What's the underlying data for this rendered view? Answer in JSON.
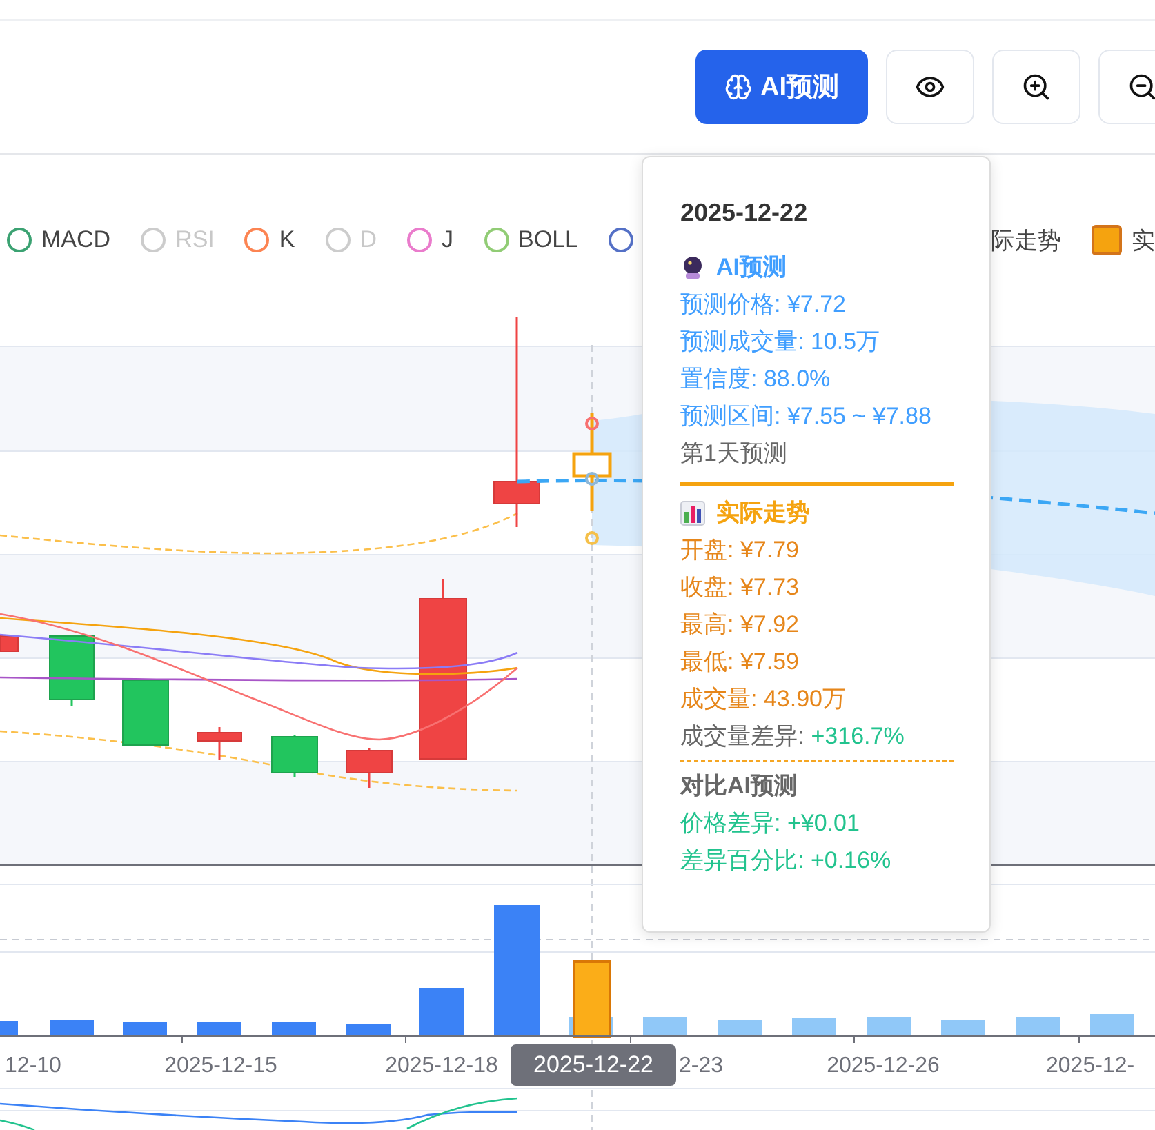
{
  "toolbar": {
    "buttons": [
      {
        "kind": "ai",
        "label": "AI预测",
        "selected": true
      },
      {
        "kind": "eye"
      },
      {
        "kind": "zoom-in"
      },
      {
        "kind": "zoom-out"
      }
    ]
  },
  "legend": [
    {
      "label": "MACD",
      "kind": "line",
      "enabled": true,
      "color": "#3ba272"
    },
    {
      "label": "RSI",
      "kind": "line",
      "enabled": false
    },
    {
      "label": "K",
      "kind": "line",
      "enabled": true,
      "color": "#fc8452"
    },
    {
      "label": "D",
      "kind": "line",
      "enabled": false
    },
    {
      "label": "J",
      "kind": "line",
      "enabled": true,
      "color": "#ea7ccc"
    },
    {
      "label": "BOLL",
      "kind": "line",
      "enabled": true,
      "color": "#91cc75"
    },
    {
      "kind": "line",
      "enabled": true,
      "color": "#5470c6"
    },
    {
      "label": "际走势",
      "kind": "text",
      "enabled": true
    },
    {
      "label": "实",
      "kind": "box",
      "enabled": true,
      "color": "#f5a30f"
    }
  ],
  "chart": {
    "x_labels": [
      "12-10",
      "2025-12-15",
      "2025-12-18",
      "2-23",
      "2025-12-26",
      "2025-12-"
    ],
    "pointer_label": "2025-12-22"
  },
  "tooltip": {
    "date": "2025-12-22",
    "prediction": {
      "title": "AI预测",
      "lines": [
        "预测价格: ¥7.72",
        "预测成交量: 10.5万",
        "置信度: 88.0%",
        "预测区间: ¥7.55 ~ ¥7.88"
      ],
      "note": "第1天预测"
    },
    "actual": {
      "title": "实际走势",
      "lines": [
        "开盘: ¥7.79",
        "收盘: ¥7.73",
        "最高: ¥7.92",
        "最低: ¥7.59",
        "成交量: 43.90万"
      ],
      "diff_label": "成交量差异:",
      "diff_value": "+316.7%"
    },
    "compare": {
      "title": "对比AI预测",
      "lines": [
        "价格差异: +¥0.01",
        "差异百分比: +0.16%"
      ]
    }
  }
}
